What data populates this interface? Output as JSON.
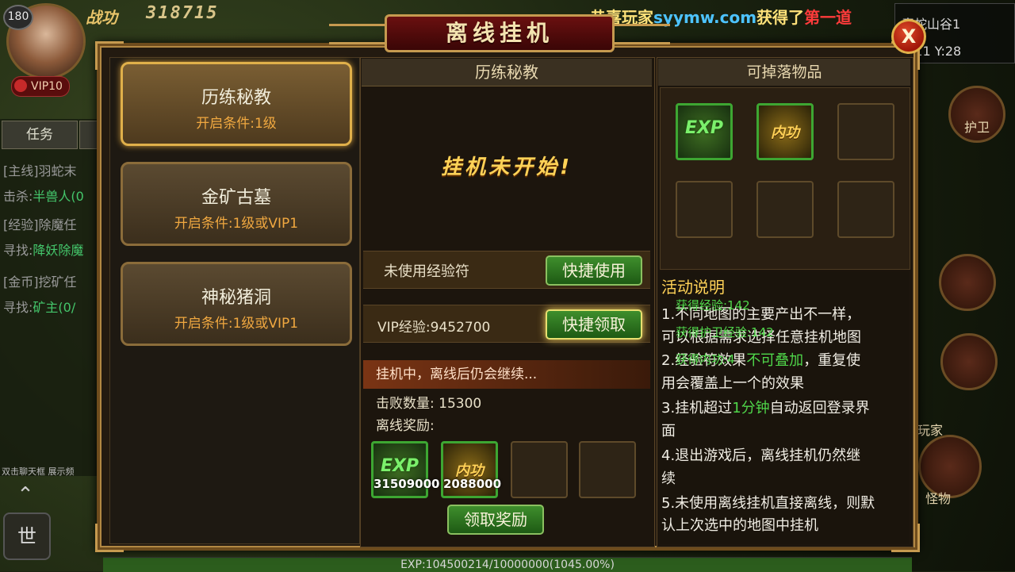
{
  "hud": {
    "level": "180",
    "vip": "VIP10",
    "power_label": "战功",
    "power_value": "318715",
    "broadcast": {
      "p1": "恭喜玩家",
      "p2": "syymw.com",
      "p3": "获得了",
      "p4": "第一道"
    },
    "minimap": {
      "place": "毒蛇山谷1",
      "coord": "X:11 Y:28"
    },
    "task_tab": "任务",
    "task_lines": [
      {
        "k": "[主线]",
        "v": "羽蛇末"
      },
      {
        "k": "击杀:",
        "v": "半兽人(0"
      },
      {
        "k": "[经验]",
        "v": "除魔任"
      },
      {
        "k": "寻找:",
        "v": "降妖除魔"
      },
      {
        "k": "[金币]",
        "v": "挖矿任"
      },
      {
        "k": "寻找:",
        "v": "矿主(0/"
      }
    ],
    "chat_hint": "双击聊天框   展示频",
    "mic_label": "世",
    "guard_label": "护卫",
    "player_label": "玩家",
    "monster_label": "怪物",
    "exp_text": "EXP:104500214/10000000(1045.00%)",
    "exp_ratio": 1.0
  },
  "dialog": {
    "title": "离线挂机",
    "close_label": "X",
    "maps": [
      {
        "name": "历练秘教",
        "cond": "开启条件:1级",
        "active": true
      },
      {
        "name": "金矿古墓",
        "cond": "开启条件:1级或VIP1",
        "active": false
      },
      {
        "name": "神秘猪洞",
        "cond": "开启条件:1级或VIP1",
        "active": false
      }
    ],
    "middle": {
      "header": "历练秘教",
      "status": "挂机未开始!",
      "unused_label": "未使用经验符",
      "quick_use": "快捷使用",
      "vip_exp_label": "VIP经验:9452700",
      "quick_claim": "快捷领取",
      "running_text": "挂机中，离线后仍会继续...",
      "kill_count": "击败数量: 15300",
      "reward_label": "离线奖励:",
      "rewards": [
        {
          "glyph": "EXP",
          "qty": "31509000"
        },
        {
          "glyph": "内功",
          "qty": "2088000"
        }
      ],
      "claim_button": "领取奖励"
    },
    "right": {
      "header": "可掉落物品",
      "drops": [
        "EXP",
        "内功"
      ],
      "desc_title": "活动说明",
      "desc": {
        "l1": "1.不同地图的主要产出不一样，",
        "l2": "可以根据需求选择任意挂机地图",
        "l3a": "2.经验符效果",
        "l3b": "不可叠加",
        "l3c": "，重复使",
        "l4": "用会覆盖上一个的效果",
        "l5a": "3.挂机超过",
        "l5b": "1分钟",
        "l5c": "自动返回登录界",
        "l6": "面",
        "l7": "4.退出游戏后，离线挂机仍然继",
        "l8": "续",
        "l9": "5.未使用离线挂机直接离线，则默",
        "l10": "认上次选中的地图中挂机"
      },
      "floats": [
        "获得经验:142",
        "获得护卫经验:142",
        "获得内功:4"
      ]
    }
  },
  "colors": {
    "gold": "#ffd257",
    "green_text": "#4fd64a",
    "frame": "#c69a4f",
    "title_red": "#6a1010"
  }
}
